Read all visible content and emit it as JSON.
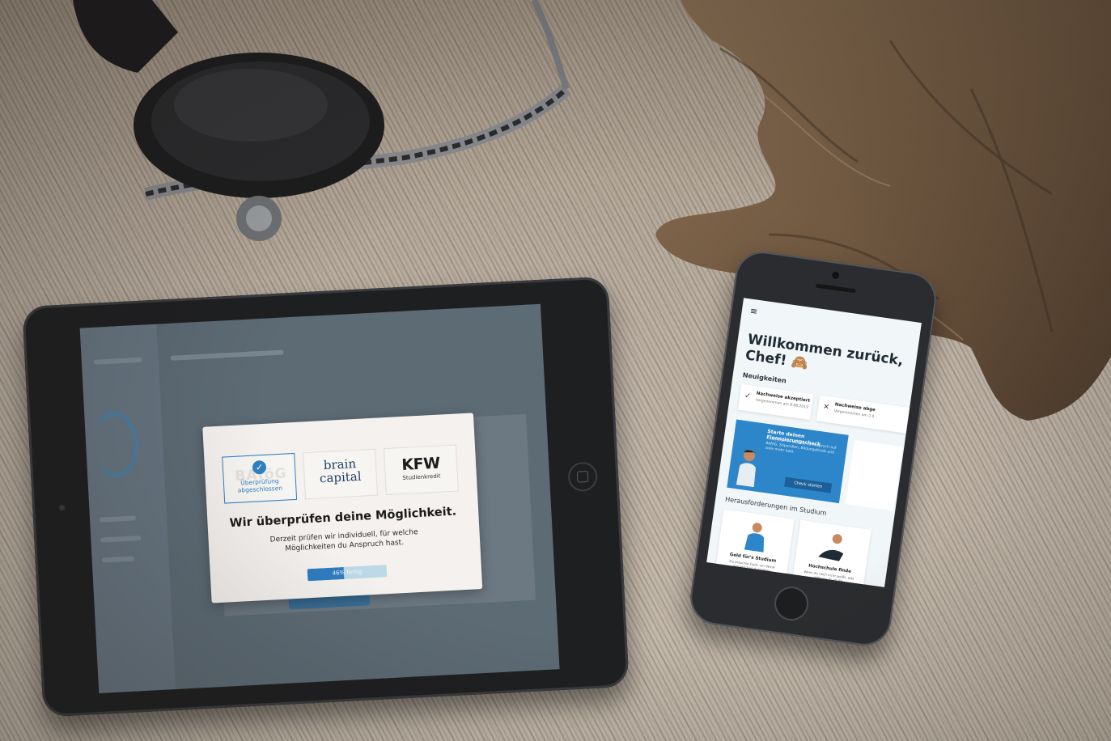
{
  "tablet": {
    "modal": {
      "logos": [
        {
          "name": "BAföG",
          "status_line1": "Überprüfung",
          "status_line2": "abgeschlossen",
          "selected": true
        },
        {
          "name_line1": "brain",
          "name_line2": "capital"
        },
        {
          "name": "KFW",
          "subtitle": "Studienkredit"
        }
      ],
      "check_glyph": "✓",
      "title": "Wir überprüfen deine Möglichkeit.",
      "text_line1": "Derzeit prüfen wir individuell, für welche",
      "text_line2": "Möglichkeiten du Anspruch hast.",
      "progress": {
        "label": "46% fertig",
        "percent": 46
      }
    }
  },
  "phone": {
    "menu_icon": "≡",
    "title_line1": "Willkommen zurück,",
    "title_line2": "Chef! 🙈",
    "news_heading": "Neuigkeiten",
    "news": [
      {
        "icon": "✓",
        "title": "Nachweise akzeptiert",
        "subtitle": "Vorgenommen am 8.08.2019"
      },
      {
        "icon": "✕",
        "title": "Nachweise abge",
        "subtitle": "Vorgenommen am 2.0"
      }
    ],
    "promo": {
      "title": "Starte deinen Finanzierungscheck",
      "body": "Finde jetzt heraus, ob du Anspruch auf BAföG, Stipendien, Bildungsfonds und viele mehr hast.",
      "button": "Check starten"
    },
    "challenges_heading": "Herausforderungen im Studium",
    "cards": [
      {
        "title": "Geld für's Studium",
        "subtitle": "Du brauchst Geld, um deine monatlichen Ausgaben"
      },
      {
        "title": "Hochschule finde",
        "subtitle": "Wenn du noch nicht weißt, was oder wo du studie"
      }
    ]
  },
  "colors": {
    "accent": "#2f7fc0",
    "overlay": "#5d6b75",
    "modal_bg": "#f4f1ee",
    "brain_red": "#d13434"
  }
}
